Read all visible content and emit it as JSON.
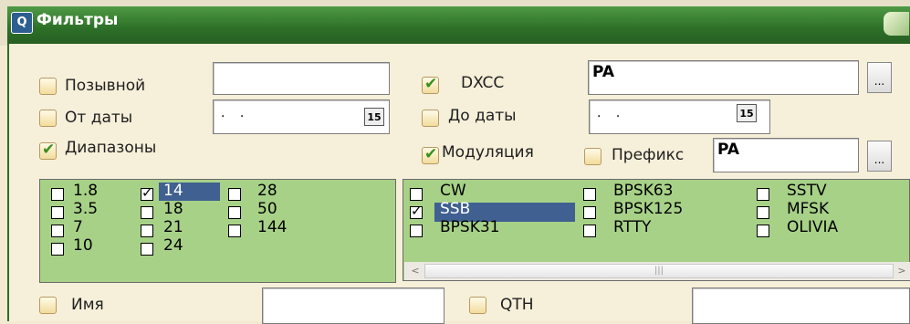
{
  "window": {
    "title": "Фильтры"
  },
  "fields": {
    "callsign": {
      "label": "Позывной",
      "value": "",
      "checked": false
    },
    "date_from": {
      "label": "От даты",
      "value": ". .",
      "checked": false
    },
    "bands": {
      "label": "Диапазоны",
      "checked": true
    },
    "dxcc": {
      "label": "DXCC",
      "value": "PA",
      "checked": true
    },
    "date_to": {
      "label": "До даты",
      "value": ". .",
      "checked": false
    },
    "modulation": {
      "label": "Модуляция",
      "checked": true
    },
    "prefix": {
      "label": "Префикс",
      "value": "PA",
      "checked": false
    },
    "name": {
      "label": "Имя",
      "value": "",
      "checked": false
    },
    "qth": {
      "label": "QTH",
      "value": "",
      "checked": false
    }
  },
  "calendar_icon_text": "15",
  "ellipsis_label": "...",
  "bands_list": [
    {
      "label": "1.8",
      "checked": false
    },
    {
      "label": "3.5",
      "checked": false
    },
    {
      "label": "7",
      "checked": false
    },
    {
      "label": "10",
      "checked": false
    },
    {
      "label": "14",
      "checked": true
    },
    {
      "label": "18",
      "checked": false
    },
    {
      "label": "21",
      "checked": false
    },
    {
      "label": "24",
      "checked": false
    },
    {
      "label": "28",
      "checked": false
    },
    {
      "label": "50",
      "checked": false
    },
    {
      "label": "144",
      "checked": false
    }
  ],
  "modes_list": [
    {
      "label": "CW",
      "checked": false
    },
    {
      "label": "SSB",
      "checked": true
    },
    {
      "label": "BPSK31",
      "checked": false
    },
    {
      "label": "BPSK63",
      "checked": false
    },
    {
      "label": "BPSK125",
      "checked": false
    },
    {
      "label": "RTTY",
      "checked": false
    },
    {
      "label": "SSTV",
      "checked": false
    },
    {
      "label": "MFSK",
      "checked": false
    },
    {
      "label": "OLIVIA",
      "checked": false
    }
  ],
  "scrollbar": {
    "left_arrow": "<",
    "right_arrow": ">",
    "thumb_grip": "|||"
  }
}
